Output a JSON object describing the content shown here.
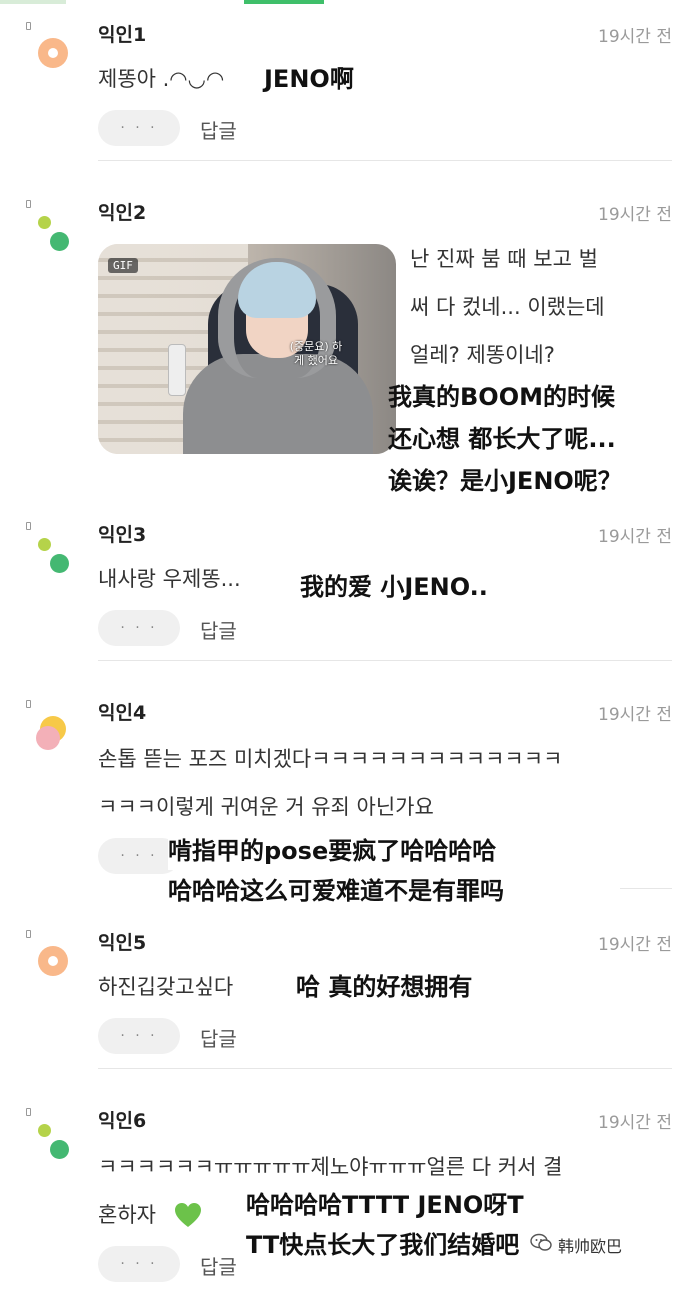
{
  "comments": [
    {
      "nick": "익인1",
      "time": "19시간 전",
      "text": "제똥아 .◠◡◠",
      "translation": "JENO啊",
      "more": "· · ·",
      "reply": "답글"
    },
    {
      "nick": "익인2",
      "time": "19시간 전",
      "text_lines": [
        "난 진짜 붐 때 보고 벌",
        "써 다 컸네... 이랬는데",
        "얼레? 제똥이네?"
      ],
      "translation_lines": [
        "我真的BOOM的时候",
        "还心想 都长大了呢...",
        "诶诶？是小JENO呢？"
      ],
      "gif_badge": "GIF",
      "gif_caption": "(중문요) 하게 했어요"
    },
    {
      "nick": "익인3",
      "time": "19시간 전",
      "text": "내사랑 우제똥...",
      "translation": "我的爱 小JENO..",
      "more": "· · ·",
      "reply": "답글"
    },
    {
      "nick": "익인4",
      "time": "19시간 전",
      "text_lines": [
        "손톱 뜯는 포즈 미치겠다ㅋㅋㅋㅋㅋㅋㅋㅋㅋㅋㅋㅋㅋ",
        "ㅋㅋㅋ이렇게 귀여운 거 유죄 아닌가요"
      ],
      "translation_lines": [
        "啃指甲的pose要疯了哈哈哈哈",
        "哈哈哈这么可爱难道不是有罪吗"
      ],
      "more": "· · ·"
    },
    {
      "nick": "익인5",
      "time": "19시간 전",
      "text": "하진깁갖고싶다",
      "translation": "哈 真的好想拥有",
      "more": "· · ·",
      "reply": "답글"
    },
    {
      "nick": "익인6",
      "time": "19시간 전",
      "text_lines": [
        "ㅋㅋㅋㅋㅋㅋㅠㅠㅠㅠㅠ제노야ㅠㅠㅠ얼른 다 커서 결",
        "혼하자"
      ],
      "translation_lines": [
        "哈哈哈哈TTTT JENO呀T",
        "TT快点长大了我们结婚吧"
      ],
      "more": "· · ·",
      "reply": "답글"
    }
  ],
  "watermark": "韩帅欧巴",
  "colors": {
    "accent_green": "#3fbf6a",
    "avatar_orange": "#f9b88a",
    "heart_green": "#6cc24a"
  },
  "icons": {
    "heart": "green-heart-icon",
    "watermark": "wechat-icon"
  }
}
